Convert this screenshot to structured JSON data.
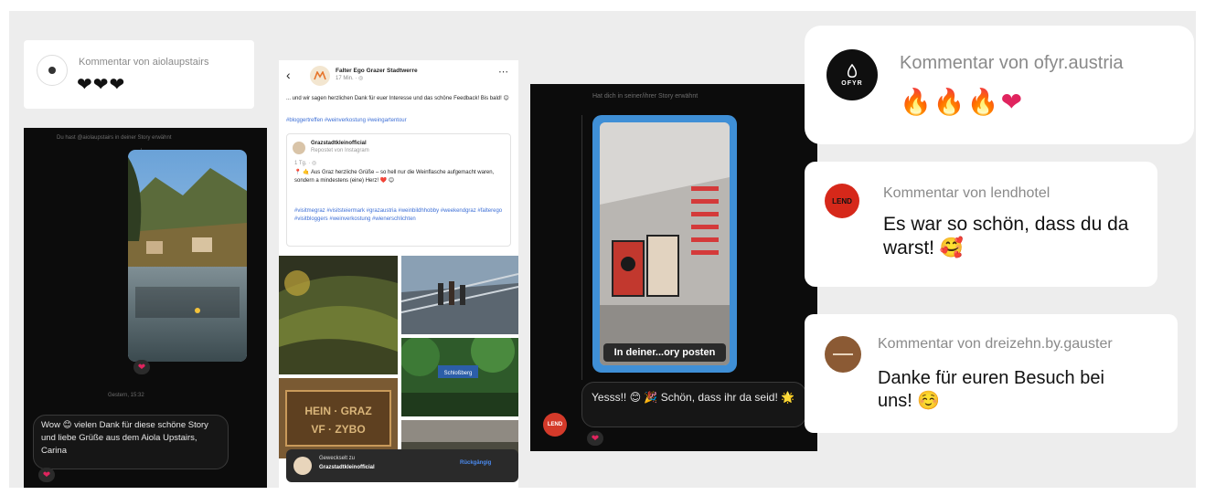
{
  "card_aiola": {
    "header": "Kommentar von aiolaupstairs",
    "body": "❤❤❤"
  },
  "chat_aiola": {
    "header": "Du hast @aiolaupstairs in deiner Story erwähnt",
    "timestamp": "Gestern, 15:32",
    "message": "Wow 😊 vielen Dank für diese schöne Story und liebe Grüße aus dem Aiola Upstairs, Carina",
    "reaction": "❤"
  },
  "fb_post": {
    "page_name": "Falter Ego Grazer Stadtwerre",
    "post_time": "17 Min. · ◎",
    "post_text": "... und wir sagen herzlichen Dank für euer Interesse und das schöne Feedback! Bis bald! 😊",
    "hashtags": "#bloggertreffen #weinverkostung #weingartentour",
    "shared_name": "Grazstadtkleinofficial",
    "shared_meta": "Repostet von Instagram",
    "shared_time": "1 Tg. · ◎",
    "shared_text": "📍 🤙 Aus Graz herzliche Grüße – so hell nur die Weinflasche aufgemacht waren, sondern a mindestens (eine) Herz! ❤️ 😊",
    "shared_tags": "#visitmegraz #visitsteiermark #grazaustria #weinbildhhobby #weekendgraz #falterego #visitbloggers #weinverkostung #wienerschlichten",
    "footer_label": "Geweckselt zu",
    "footer_name": "Grazstadtkleinofficial",
    "footer_action": "Rückgängig",
    "sign_text": "HEIN · GRAZ\nVF · ZYBO",
    "park_sign": "Schloßberg"
  },
  "chat_story": {
    "header": "Hat dich in seiner/ihrer Story erwähnt",
    "story_button": "In deiner...ory posten",
    "message": "Yesss!! 😊 🎉 Schön, dass ihr da seid! 🌟",
    "avatar_text": "LEND",
    "reaction": "❤"
  },
  "card_ofyr": {
    "header": "Kommentar von ofyr.austria",
    "logo_text": "OFYR",
    "fire": "🔥",
    "heart": "❤"
  },
  "card_lend": {
    "header": "Kommentar von lendhotel",
    "logo_text": "LEND",
    "body": "Es war so schön, dass du da warst! 🥰"
  },
  "card_dreizehn": {
    "header": "Kommentar von dreizehn.by.gauster",
    "body": "Danke für euren Besuch bei uns! ☺️"
  },
  "colors": {
    "instagram_heart": "#e0245e",
    "dark_bg": "#0c0c0c",
    "link_blue": "#3d6fd6",
    "story_frame": "#3f8fd6"
  }
}
